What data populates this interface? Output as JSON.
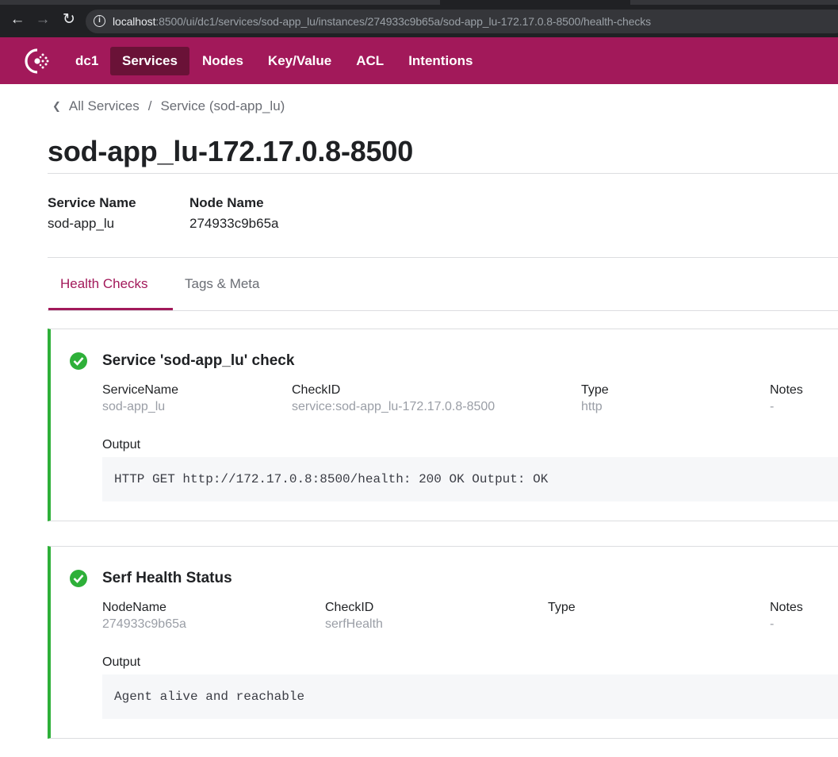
{
  "browser": {
    "url_host": "localhost",
    "url_rest": ":8500/ui/dc1/services/sod-app_lu/instances/274933c9b65a/sod-app_lu-172.17.0.8-8500/health-checks",
    "icons": {
      "back": "arrow-left-icon",
      "forward": "arrow-right-icon",
      "reload": "reload-icon",
      "info": "info-icon"
    }
  },
  "header": {
    "datacenter": "dc1",
    "nav": [
      {
        "label": "Services",
        "active": true
      },
      {
        "label": "Nodes",
        "active": false
      },
      {
        "label": "Key/Value",
        "active": false
      },
      {
        "label": "ACL",
        "active": false
      },
      {
        "label": "Intentions",
        "active": false
      }
    ],
    "colors": {
      "brand": "#a2195a",
      "active_nav": "#6a1237"
    }
  },
  "breadcrumb": {
    "all_services": "All Services",
    "separator": "/",
    "service": "Service (sod-app_lu)"
  },
  "page": {
    "title": "sod-app_lu-172.17.0.8-8500",
    "service_name_label": "Service Name",
    "service_name_value": "sod-app_lu",
    "node_name_label": "Node Name",
    "node_name_value": "274933c9b65a"
  },
  "tabs": [
    {
      "label": "Health Checks",
      "active": true
    },
    {
      "label": "Tags & Meta",
      "active": false
    }
  ],
  "checks": [
    {
      "status": "passing",
      "title": "Service 'sod-app_lu' check",
      "fields": [
        {
          "label": "ServiceName",
          "value": "sod-app_lu"
        },
        {
          "label": "CheckID",
          "value": "service:sod-app_lu-172.17.0.8-8500"
        },
        {
          "label": "Type",
          "value": "http"
        },
        {
          "label": "Notes",
          "value": "-"
        }
      ],
      "output_label": "Output",
      "output": "HTTP GET http://172.17.0.8:8500/health: 200 OK Output: OK"
    },
    {
      "status": "passing",
      "title": "Serf Health Status",
      "fields": [
        {
          "label": "NodeName",
          "value": "274933c9b65a"
        },
        {
          "label": "CheckID",
          "value": "serfHealth"
        },
        {
          "label": "Type",
          "value": ""
        },
        {
          "label": "Notes",
          "value": "-"
        }
      ],
      "output_label": "Output",
      "output": "Agent alive and reachable"
    }
  ],
  "status_color": "#2eb039"
}
